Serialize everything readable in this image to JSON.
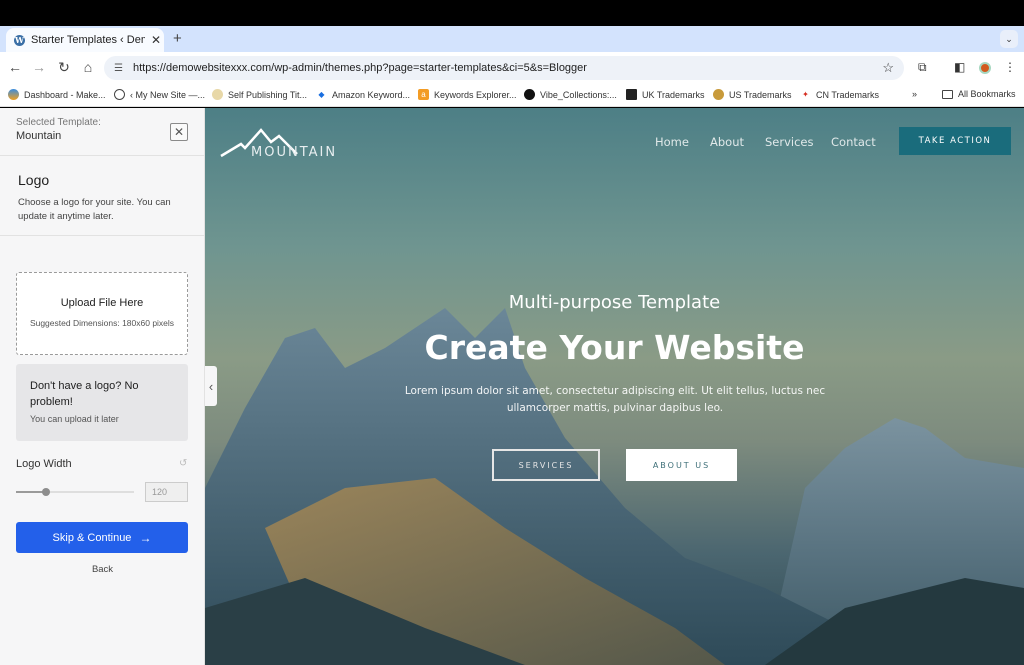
{
  "browser": {
    "tab": {
      "title": "Starter Templates ‹ Demo Website",
      "favicon": "wordpress-icon"
    },
    "new_tab_label": "+",
    "url": "https://demowebsitexxx.com/wp-admin/themes.php?page=starter-templates&ci=5&s=Blogger",
    "bookmarks": [
      {
        "label": "Dashboard - Make...",
        "icon": "dashboard-favicon"
      },
      {
        "label": "‹ My New Site —...",
        "icon": "globe-icon"
      },
      {
        "label": "Self Publishing Tit...",
        "icon": "publishing-favicon"
      },
      {
        "label": "Amazon Keyword...",
        "icon": "diamond-favicon"
      },
      {
        "label": "Keywords Explorer...",
        "icon": "ahrefs-favicon"
      },
      {
        "label": "Vibe_Collections:...",
        "icon": "vibe-favicon"
      },
      {
        "label": "UK Trademarks",
        "icon": "uk-trademarks-favicon"
      },
      {
        "label": "US Trademarks",
        "icon": "us-trademarks-favicon"
      },
      {
        "label": "CN Trademarks",
        "icon": "maple-leaf-favicon"
      }
    ],
    "bookmarks_overflow": "»",
    "all_bookmarks_label": "All Bookmarks"
  },
  "sidebar": {
    "selected_template_label": "Selected Template:",
    "selected_template_name": "Mountain",
    "section_title": "Logo",
    "section_description": "Choose a logo for your site. You can update it anytime later.",
    "upload": {
      "title": "Upload File Here",
      "hint": "Suggested Dimensions: 180x60 pixels"
    },
    "no_logo": {
      "title": "Don't have a logo? No problem!",
      "subtitle": "You can upload it later"
    },
    "logo_width": {
      "label": "Logo Width",
      "value": "120",
      "slider_fraction": 0.25
    },
    "primary_button": "Skip & Continue",
    "primary_button_arrow": "→",
    "back_link": "Back",
    "accent_color": "#2360ea"
  },
  "preview": {
    "brand_name": "MOUNTAIN",
    "menu": [
      "Home",
      "About",
      "Services",
      "Contact"
    ],
    "cta": "TAKE ACTION",
    "hero_subtitle": "Multi-purpose Template",
    "hero_title": "Create Your Website",
    "hero_body": "Lorem ipsum dolor sit amet, consectetur adipiscing elit. Ut elit tellus, luctus nec ullamcorper mattis, pulvinar dapibus leo.",
    "buttons": [
      "SERVICES",
      "ABOUT US"
    ],
    "cta_color": "#1a6c7c"
  }
}
